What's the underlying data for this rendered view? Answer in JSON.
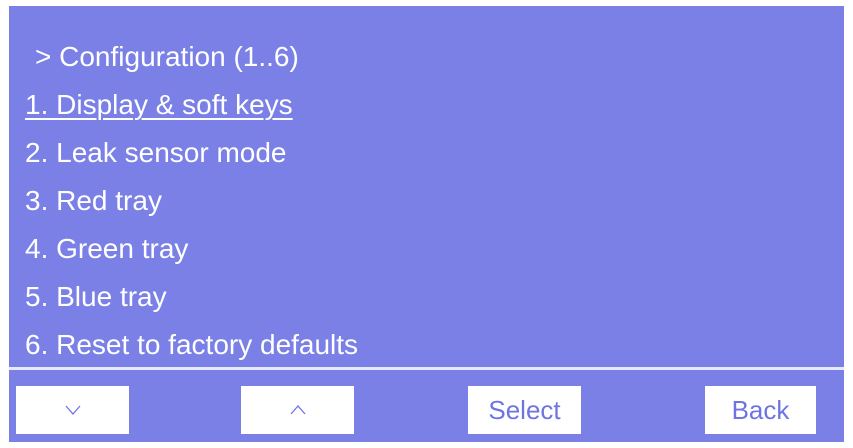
{
  "menu": {
    "title": "> Configuration (1..6)",
    "items": [
      "1. Display & soft keys",
      "2. Leak sensor mode",
      "3. Red tray",
      "4. Green tray",
      "5. Blue tray",
      "6. Reset to factory defaults"
    ],
    "selected_index": 0
  },
  "softkeys": {
    "down_icon": "chevron-down-icon",
    "up_icon": "chevron-up-icon",
    "select_label": "Select",
    "back_label": "Back"
  },
  "colors": {
    "background": "#7b80e6",
    "text": "#ffffff",
    "softkey_background": "#ffffff",
    "softkey_text": "#6f74e4",
    "divider": "#e8eaff"
  }
}
